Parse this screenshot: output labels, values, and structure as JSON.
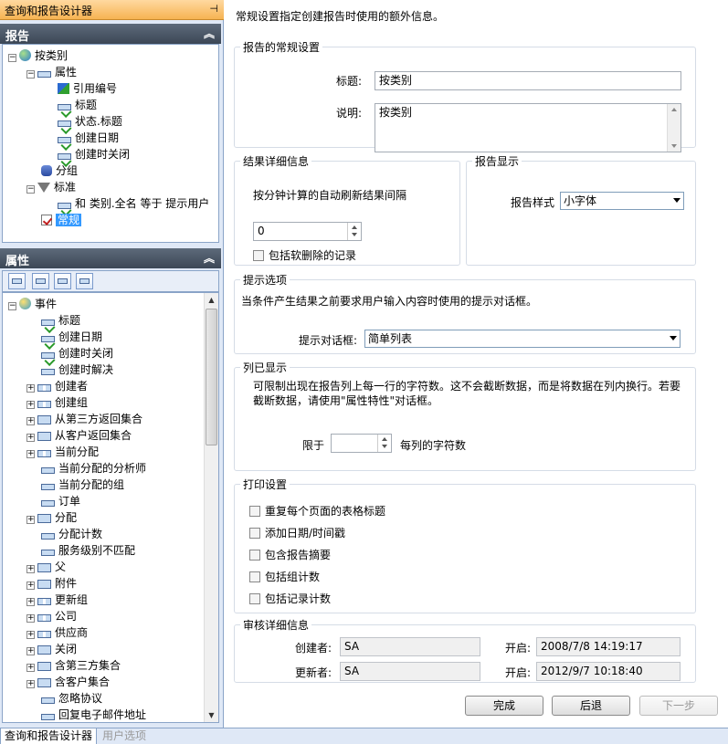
{
  "designer": {
    "title": "查询和报告设计器",
    "pin_icon": "pin-icon"
  },
  "report_panel": {
    "title": "报告",
    "tree": [
      {
        "label": "按类别",
        "icon": "globe-icon"
      },
      {
        "label": "属性",
        "icon": "field-icon"
      },
      {
        "label": "引用编号",
        "icon": "reference-icon"
      },
      {
        "label": "标题",
        "icon": "field-check-icon"
      },
      {
        "label": "状态.标题",
        "icon": "field-check-icon"
      },
      {
        "label": "创建日期",
        "icon": "field-check-icon"
      },
      {
        "label": "创建时关闭",
        "icon": "field-check-icon"
      },
      {
        "label": "分组",
        "icon": "database-icon"
      },
      {
        "label": "标准",
        "icon": "filter-icon"
      },
      {
        "label": "和 类别.全名 等于 提示用户",
        "icon": "field-check-icon"
      },
      {
        "label": "常规",
        "icon": "checkbox-icon",
        "selected": true
      }
    ]
  },
  "props_panel": {
    "title": "属性",
    "tree": [
      {
        "label": "事件",
        "expander": "−",
        "icon": "event-icon"
      },
      {
        "label": "标题",
        "icon": "field-check-icon"
      },
      {
        "label": "创建日期",
        "icon": "field-check-icon"
      },
      {
        "label": "创建时关闭",
        "icon": "field-check-icon"
      },
      {
        "label": "创建时解决",
        "icon": "field-icon"
      },
      {
        "label": "创建者",
        "expander": "+",
        "icon": "group-icon"
      },
      {
        "label": "创建组",
        "expander": "+",
        "icon": "group-icon"
      },
      {
        "label": "从第三方返回集合",
        "expander": "+",
        "icon": "flow-icon"
      },
      {
        "label": "从客户返回集合",
        "expander": "+",
        "icon": "flow-icon"
      },
      {
        "label": "当前分配",
        "expander": "+",
        "icon": "group-icon"
      },
      {
        "label": "当前分配的分析师",
        "icon": "field-icon"
      },
      {
        "label": "当前分配的组",
        "icon": "field-icon"
      },
      {
        "label": "订单",
        "icon": "field-icon"
      },
      {
        "label": "分配",
        "expander": "+",
        "icon": "flow-icon"
      },
      {
        "label": "分配计数",
        "icon": "field-icon"
      },
      {
        "label": "服务级别不匹配",
        "icon": "field-icon"
      },
      {
        "label": "父",
        "expander": "+",
        "icon": "flow-icon"
      },
      {
        "label": "附件",
        "expander": "+",
        "icon": "flow-icon"
      },
      {
        "label": "更新组",
        "expander": "+",
        "icon": "group-icon"
      },
      {
        "label": "公司",
        "expander": "+",
        "icon": "group-icon"
      },
      {
        "label": "供应商",
        "expander": "+",
        "icon": "group-icon"
      },
      {
        "label": "关闭",
        "expander": "+",
        "icon": "flow-icon"
      },
      {
        "label": "含第三方集合",
        "expander": "+",
        "icon": "flow-icon"
      },
      {
        "label": "含客户集合",
        "expander": "+",
        "icon": "flow-icon"
      },
      {
        "label": "忽略协议",
        "icon": "field-icon"
      },
      {
        "label": "回复电子邮件地址",
        "icon": "field-icon"
      }
    ]
  },
  "tabs": {
    "active": "查询和报告设计器",
    "inactive": "用户选项"
  },
  "main": {
    "intro": "常规设置指定创建报告时使用的额外信息。",
    "general": {
      "legend": "报告的常规设置",
      "title_label": "标题:",
      "title_value": "按类别",
      "desc_label": "说明:",
      "desc_value": "按类别"
    },
    "results": {
      "legend": "结果详细信息",
      "refresh_label": "按分钟计算的自动刷新结果间隔",
      "refresh_value": "0",
      "include_deleted": "包括软删除的记录"
    },
    "display": {
      "legend": "报告显示",
      "style_label": "报告样式",
      "style_value": "小字体"
    },
    "prompt": {
      "legend": "提示选项",
      "text": "当条件产生结果之前要求用户输入内容时使用的提示对话框。",
      "dialog_label": "提示对话框:",
      "dialog_value": "简单列表"
    },
    "columns": {
      "legend": "列已显示",
      "text": "可限制出现在报告列上每一行的字符数。这不会截断数据，而是将数据在列内换行。若要截断数据，请使用\"属性特性\"对话框。",
      "limit_label": "限于",
      "limit_value": "",
      "suffix": "每列的字符数"
    },
    "print": {
      "legend": "打印设置",
      "options": [
        "重复每个页面的表格标题",
        "添加日期/时间戳",
        "包含报告摘要",
        "包括组计数",
        "包括记录计数"
      ]
    },
    "audit": {
      "legend": "审核详细信息",
      "created_by_label": "创建者:",
      "created_by": "SA",
      "created_open_label": "开启:",
      "created_open": "2008/7/8 14:19:17",
      "updated_by_label": "更新者:",
      "updated_by": "SA",
      "updated_open_label": "开启:",
      "updated_open": "2012/9/7 10:18:40"
    },
    "buttons": {
      "finish": "完成",
      "back": "后退",
      "next": "下一步"
    }
  }
}
